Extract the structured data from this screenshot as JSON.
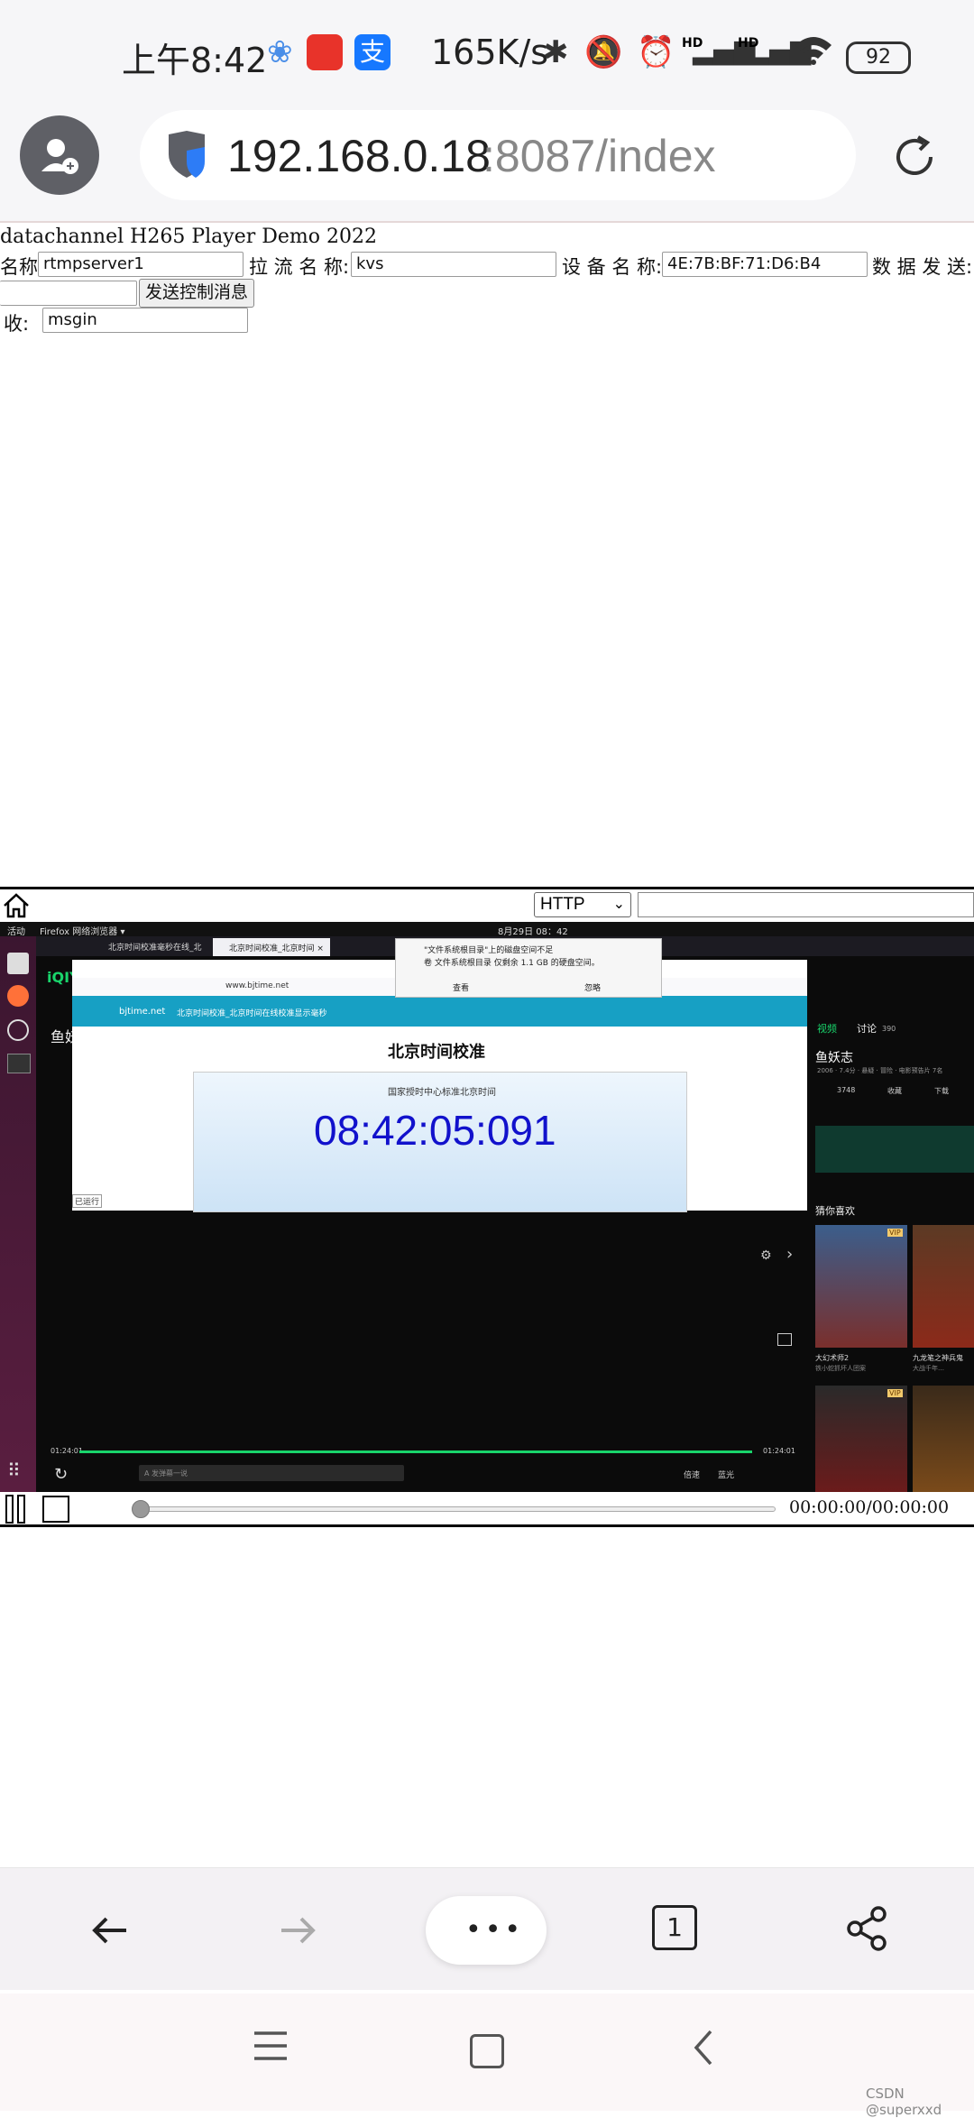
{
  "status_bar": {
    "time": "上午8:42",
    "network_speed": "165K/s",
    "battery": "92",
    "signal_label_1": "HD",
    "signal_label_2": "HD"
  },
  "browser": {
    "url_host": "192.168.0.18",
    "url_path": ":8087/index",
    "tab_count": "1"
  },
  "page": {
    "title": "datachannel H265 Player Demo 2022",
    "server_name_label": "名称:",
    "server_name_value": "rtmpserver1",
    "pull_stream_label": "拉 流 名 称:",
    "pull_stream_value": "kvs",
    "device_name_label": "设 备 名 称:",
    "device_name_value": "4E:7B:BF:71:D6:B4",
    "data_send_label": "数 据 发 送:",
    "data_send_value": "",
    "send_button": "发送控制消息",
    "receive_label": "收:",
    "receive_value": "msgin"
  },
  "player": {
    "protocol_selected": "HTTP",
    "time_readout": "00:00:00/00:00:00"
  },
  "video_content": {
    "os_activities": "活动",
    "os_app_menu": "Firefox 网络浏览器 ▾",
    "os_clock": "8月29日 08：42",
    "tab1": "北京时间校准毫秒在线_北",
    "tab2": "北京时间校准_北京时间 ×",
    "site_url": "www.bjtime.net",
    "site_logo": "bjtime.net",
    "site_banner": "北京时间校准_北京时间在线校准显示毫秒",
    "site_heading": "北京时间校准",
    "site_sub": "国家授时中心标准北京时间",
    "site_clock": "08:42:05:091",
    "notice_line1": "\"文件系统根目录\"上的磁盘空间不足",
    "notice_line2": "卷 文件系统根目录 仅剩余 1.1 GB 的硬盘空间。",
    "notice_btn1": "查看",
    "notice_btn2": "忽略",
    "iqiyi_logo": "iQIY",
    "video_title_left": "鱼妖",
    "side_tab_video": "视频",
    "side_tab_discuss": "讨论",
    "side_discuss_count": "390",
    "show_title": "鱼妖志",
    "show_meta": "2006 · 7.4分 · 悬疑 · 冒险 · 电影预告片 7名",
    "like_count": "3748",
    "collect": "收藏",
    "download": "下载",
    "guess_like": "猜你喜欢",
    "rec1": "大幻术师2",
    "rec1_sub": "铁小蛇抓坏人团案",
    "rec2": "九龙笔之神兵鬼",
    "rec2_sub": "大战千年…",
    "vip": "VIP",
    "time_start": "01:24:01",
    "time_end": "01:24:01",
    "danmaku_placeholder": "A 发弹幕一说",
    "speed": "倍速",
    "quality": "蓝光",
    "timer_label": "已运行",
    "watermark": "CSDN @superxxd"
  }
}
